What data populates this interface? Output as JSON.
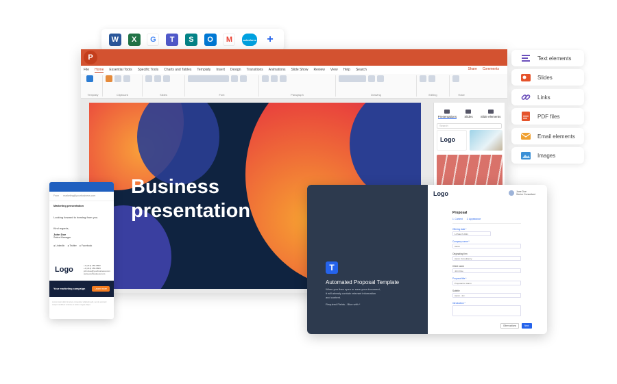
{
  "apps": [
    "W",
    "X",
    "G",
    "T",
    "S",
    "O",
    "M",
    "salesforce",
    "+"
  ],
  "ppt": {
    "logo": "P",
    "menu": [
      "File",
      "Home",
      "Essential Tools",
      "Specific Tools",
      "Charts and Tables",
      "Templafy",
      "Insert",
      "Design",
      "Transitions",
      "Animations",
      "Slide Show",
      "Review",
      "View",
      "Help",
      "Search"
    ],
    "share": "Share",
    "comments": "Comments",
    "ribbon_groups": [
      "Templafy",
      "Clipboard",
      "Slides",
      "Font",
      "Paragraph",
      "Drawing",
      "Editing",
      "Voice"
    ],
    "slide_title_line1": "Business",
    "slide_title_line2": "presentation",
    "addin": {
      "tabs": [
        "Presentations",
        "Slides",
        "Slide elements"
      ],
      "search_placeholder": "Search",
      "thumb_logo": "Logo"
    }
  },
  "features": [
    {
      "label": "Text elements",
      "icon": "text-icon",
      "color": "#6b4fbb"
    },
    {
      "label": "Slides",
      "icon": "slides-icon",
      "color": "#e5532b"
    },
    {
      "label": "Links",
      "icon": "link-icon",
      "color": "#6b4fbb"
    },
    {
      "label": "PDF files",
      "icon": "pdf-icon",
      "color": "#e5532b"
    },
    {
      "label": "Email elements",
      "icon": "email-icon",
      "color": "#f0a030"
    },
    {
      "label": "Images",
      "icon": "image-icon",
      "color": "#3a8fd6"
    }
  ],
  "email": {
    "from_label": "From",
    "from_value": "marketing@yourbusiness.com",
    "subject": "Marketing presentation",
    "message": "Looking forward to hearing from you.",
    "regards": "Kind regards,",
    "name": "John Doe",
    "role": "Sales Manager",
    "socials": [
      "LinkedIn",
      "Twitter",
      "Facebook"
    ],
    "logo": "Logo",
    "contact": [
      "+1 (212) 456-6882",
      "+1 (212) 456-6883",
      "john.doe@yourbusiness.com",
      "www.yourbusiness.com"
    ],
    "banner_text": "Your marketing campaign",
    "banner_button": "Learn more",
    "footer": "Lorem ipsum dolor sit amet, consectetur adipiscing elit, sed do eiusmod tempor incididunt ut labore et dolore magna aliqua."
  },
  "template": {
    "icon": "T",
    "title": "Automated Proposal Template",
    "description": "When you then open or save your document, it will already contain relevant information and content.",
    "required": "Required Fields - Blue with *",
    "logo": "Logo",
    "user_name": "Jane Doe",
    "user_role": "Senior Consultant",
    "form_title": "Proposal",
    "form_tabs": [
      "1. Content",
      "2. Appearance"
    ],
    "fields": [
      {
        "label": "Offering date *",
        "value": "14 March 2021",
        "required": true
      },
      {
        "label": "Company name *",
        "value": "Aaron",
        "required": true
      },
      {
        "label": "Originating firm",
        "value": "Aaron Consultancy",
        "required": false
      },
      {
        "label": "Client name",
        "value": "John Doe",
        "required": false
      },
      {
        "label": "Proposal title *",
        "value": "Proposal for Aaron",
        "required": true
      },
      {
        "label": "Subtitle",
        "value": "Aaron - Inc.",
        "required": false
      },
      {
        "label": "Introduction *",
        "value": "",
        "required": true
      }
    ],
    "btn_other": "Other actions",
    "btn_next": "Next"
  }
}
